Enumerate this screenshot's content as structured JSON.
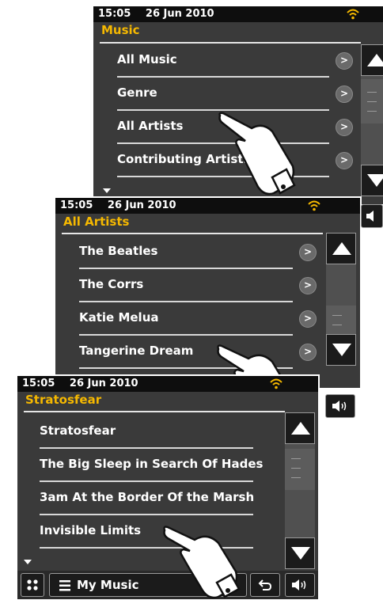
{
  "screen1": {
    "status": {
      "time": "15:05",
      "date": "26 Jun 2010"
    },
    "title": "Music",
    "items": [
      {
        "label": "All Music"
      },
      {
        "label": "Genre"
      },
      {
        "label": "All Artists"
      },
      {
        "label": "Contributing Artists"
      }
    ],
    "arrow": ">"
  },
  "screen2": {
    "status": {
      "time": "15:05",
      "date": "26 Jun 2010"
    },
    "title": "All Artists",
    "items": [
      {
        "label": "The Beatles"
      },
      {
        "label": "The Corrs"
      },
      {
        "label": "Katie Melua"
      },
      {
        "label": "Tangerine Dream"
      }
    ],
    "arrow": ">"
  },
  "screen3": {
    "status": {
      "time": "15:05",
      "date": "26 Jun 2010"
    },
    "title": "Stratosfear",
    "items": [
      {
        "label": "Stratosfear"
      },
      {
        "label": "The Big Sleep in Search Of Hades"
      },
      {
        "label": "3am At the Border Of the Marsh"
      },
      {
        "label": "Invisible Limits"
      }
    ],
    "bottom_label": "My Music"
  },
  "colors": {
    "accent": "#f5b800",
    "background": "#3a3a3a",
    "statusbar": "#0e0e0e"
  },
  "icons": [
    "wifi-icon",
    "chevron-right-icon",
    "scroll-up-icon",
    "scroll-down-icon",
    "volume-icon",
    "grid-icon",
    "menu-icon",
    "back-icon",
    "pointing-hand-icon"
  ]
}
